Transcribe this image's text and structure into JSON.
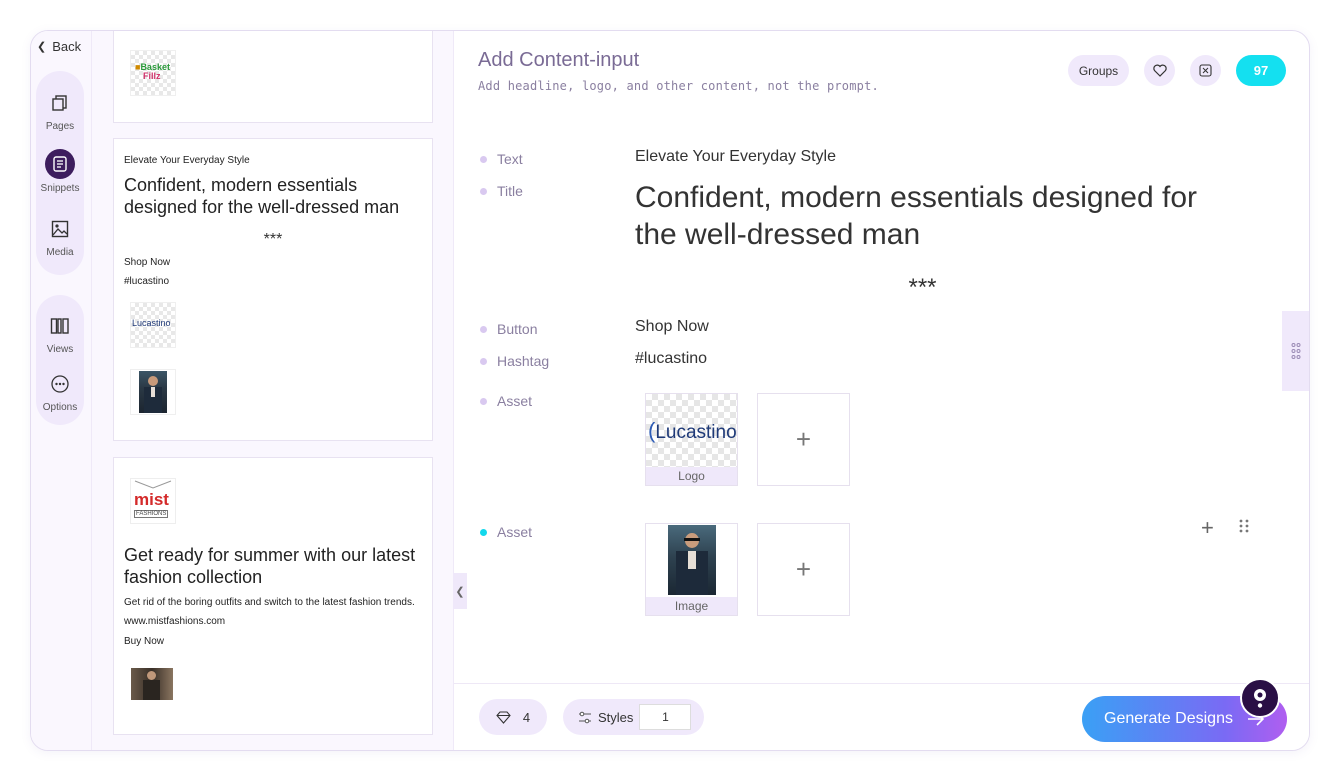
{
  "rail": {
    "back": "Back",
    "items": [
      {
        "label": "Pages",
        "icon": "pages-icon"
      },
      {
        "label": "Snippets",
        "icon": "snippets-icon"
      },
      {
        "label": "Media",
        "icon": "media-icon"
      },
      {
        "label": "Views",
        "icon": "views-icon"
      },
      {
        "label": "Options",
        "icon": "options-icon"
      }
    ]
  },
  "snippets": {
    "card1": {
      "logo_text_1": "Basket",
      "logo_text_2": "Fillz"
    },
    "card2": {
      "text": "Elevate Your Everyday Style",
      "title": "Confident, modern essentials designed for the well-dressed man",
      "separator": "***",
      "button": "Shop Now",
      "hashtag": "#lucastino",
      "logo_text": "Lucastino"
    },
    "card3": {
      "logo_text_1": "mist",
      "logo_text_2": "FASHIONS",
      "title": "Get ready for summer with our latest fashion collection",
      "body": "Get rid of the boring outfits and switch to the latest fashion trends.",
      "url": "www.mistfashions.com",
      "button": "Buy Now"
    }
  },
  "header": {
    "title": "Add Content-input",
    "subtitle": "Add headline, logo, and other content, not the prompt.",
    "groups_label": "Groups",
    "credits": "97"
  },
  "content": {
    "rows": [
      {
        "label": "Text",
        "value": "Elevate Your Everyday Style"
      },
      {
        "label": "Title",
        "value": "Confident, modern essentials designed for the well-dressed man"
      },
      {
        "label": "Button",
        "value": "Shop Now"
      },
      {
        "label": "Hashtag",
        "value": "#lucastino"
      },
      {
        "label": "Asset"
      },
      {
        "label": "Asset"
      }
    ],
    "separator": "***",
    "asset1": {
      "logo_text": "Lucastino",
      "caption": "Logo"
    },
    "asset2": {
      "caption": "Image"
    },
    "plus": "+"
  },
  "footer": {
    "count": "4",
    "styles_label": "Styles",
    "styles_value": "1",
    "generate_label": "Generate Designs"
  },
  "colors": {
    "accent_cyan": "#14e0f0",
    "rail_active": "#3d1d5e",
    "pill_bg": "#f0e9fb"
  }
}
